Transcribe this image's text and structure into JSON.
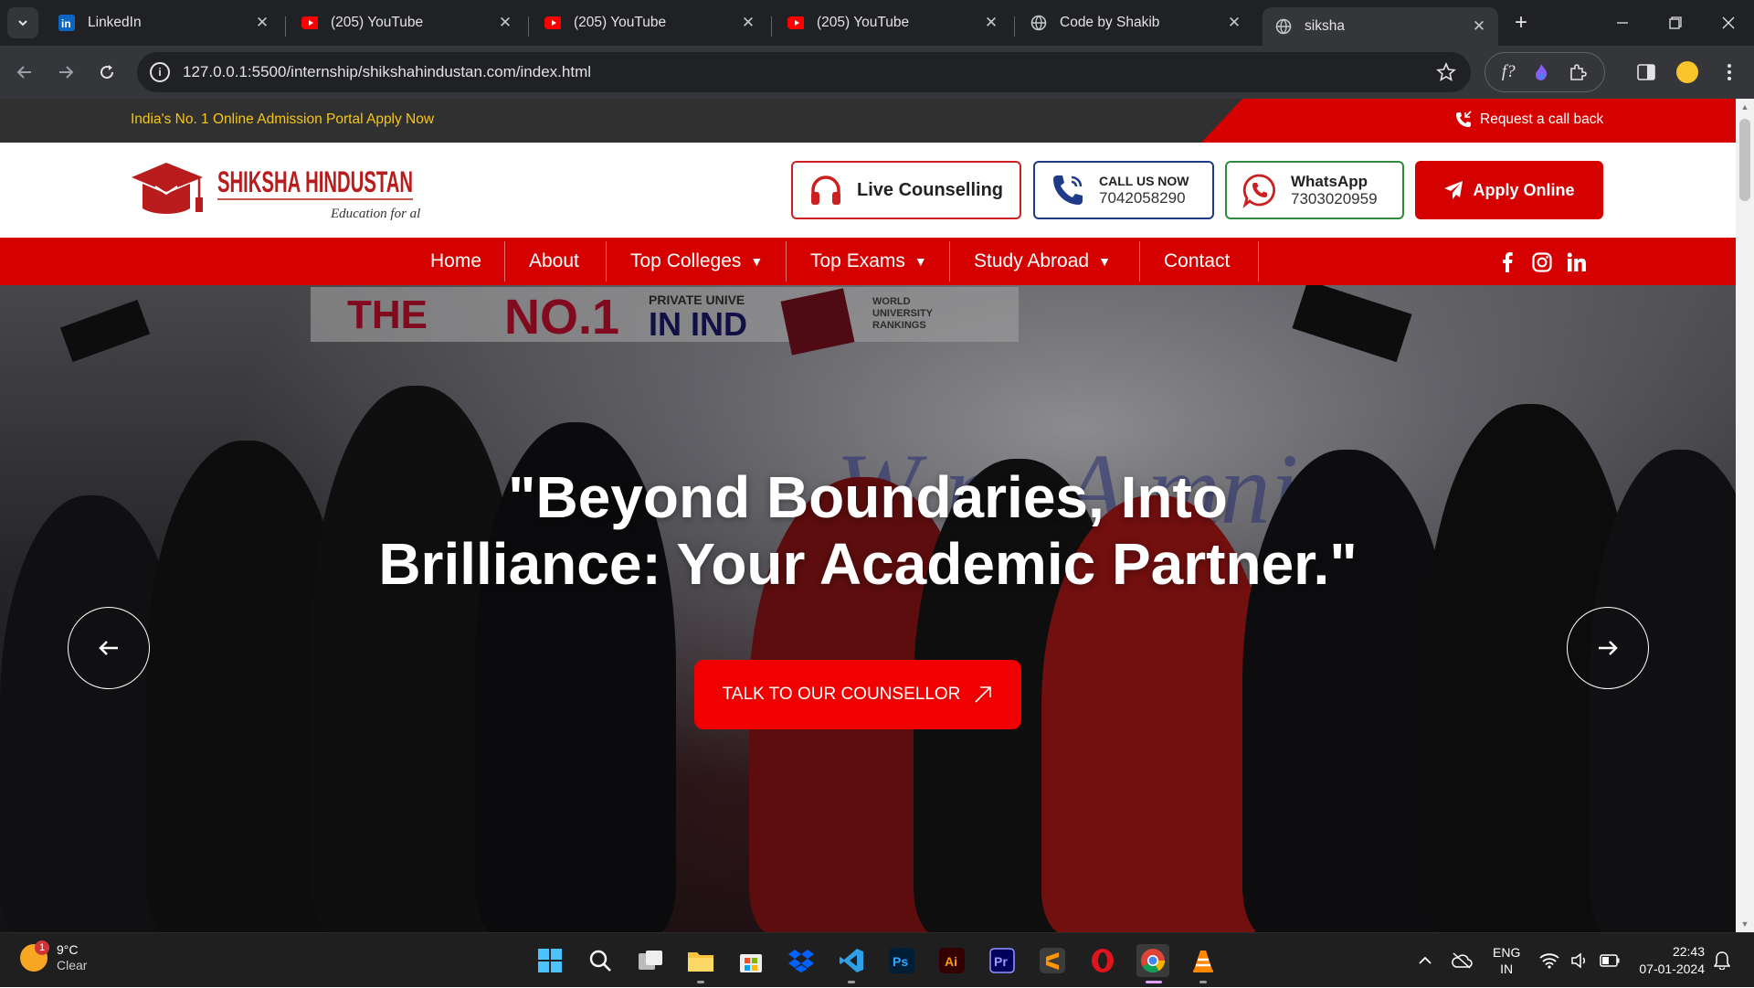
{
  "browser": {
    "tabs": [
      {
        "title": "LinkedIn",
        "icon": "linkedin-icon"
      },
      {
        "title": "(205) YouTube",
        "icon": "youtube-icon"
      },
      {
        "title": "(205) YouTube",
        "icon": "youtube-icon"
      },
      {
        "title": "(205) YouTube",
        "icon": "youtube-icon"
      },
      {
        "title": "Code by Shakib",
        "icon": "globe-icon"
      },
      {
        "title": "siksha",
        "icon": "globe-icon",
        "active": true
      }
    ],
    "url": "127.0.0.1:5500/internship/shikshahindustan.com/index.html"
  },
  "site": {
    "topbar": {
      "promo": "India's No. 1 Online Admission Portal Apply Now",
      "callback": "Request a call back"
    },
    "logo": {
      "name": "SHIKSHA HINDUSTAN",
      "tagline": "Education for all"
    },
    "header": {
      "live_counselling": "Live Counselling",
      "call_label": "CALL US NOW",
      "call_number": "7042058290",
      "whatsapp_label": "WhatsApp",
      "whatsapp_number": "7303020959",
      "apply": "Apply Online"
    },
    "nav": [
      "Home",
      "About",
      "Top Colleges",
      "Top Exams",
      "Study Abroad",
      "Contact"
    ],
    "hero": {
      "headline_line1": "\"Beyond Boundaries, Into",
      "headline_line2": "Brilliance: Your Academic Partner.\"",
      "cta": "TALK TO OUR COUNSELLOR",
      "banner_the": "THE",
      "banner_no1": "NO.1",
      "banner_private": "PRIVATE UNIVE",
      "banner_india": "IN IND",
      "banner_rankings": "WORLD UNIVERSITY RANKINGS",
      "bg_text": "W      ne A   mni"
    }
  },
  "taskbar": {
    "weather_temp": "9°C",
    "weather_desc": "Clear",
    "weather_badge": "1",
    "lang1": "ENG",
    "lang2": "IN",
    "time": "22:43",
    "date": "07-01-2024"
  },
  "colors": {
    "brand_red": "#d50000",
    "topbar_dark": "#303030",
    "promo_yellow": "#f5c518"
  }
}
